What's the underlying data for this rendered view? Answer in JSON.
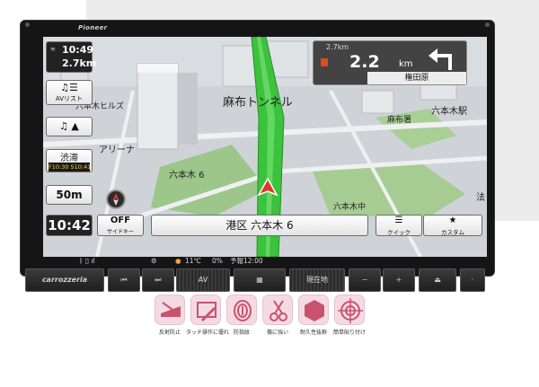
{
  "unit": {
    "brand": "Pioneer",
    "logo": "carrozzeria"
  },
  "top_left": {
    "signal": "≋",
    "time": "10:49",
    "distance": "2.7km"
  },
  "av_button": {
    "icon": "music-list-icon",
    "glyph": "♫☰",
    "label": "AVリスト"
  },
  "music_button": {
    "glyph": "♫ ▲"
  },
  "traffic": {
    "label": "渋滞",
    "times": "F10:30 S10:41"
  },
  "scale_label": "50m",
  "bottom_time": "10:42",
  "off_button": {
    "label": "OFF",
    "sub": "サイドキー"
  },
  "address": "港区 六本木 6",
  "quick_button": {
    "glyph": "☰",
    "label": "クイック"
  },
  "custom_button": {
    "glyph": "★",
    "label": "カスタム"
  },
  "guidance": {
    "small_distance": "2.7km",
    "distance": "2.2",
    "unit": "km",
    "place": "権田原",
    "direction": "left"
  },
  "map_labels": {
    "tunnel": "麻布トンネル",
    "roppongi_hills": "六本木ヒルズ",
    "arena": "アリーナ",
    "roppongi6": "六本木 6",
    "roppongi_naka": "六本木中",
    "azabu_police": "麻布署",
    "roppongi_station": "六本木駅",
    "ho": "法"
  },
  "status_bar": {
    "temp": "11℃",
    "precip": "0%",
    "forecast": "予報12:00"
  },
  "hardware_keys": {
    "prev": "⏮",
    "next": "⏭",
    "av": "AV",
    "menu": "▦",
    "current": "現在地",
    "vol_down": "−",
    "vol_up": "+",
    "eject": "⏏",
    "reset": "·"
  },
  "features": [
    {
      "label": "反射防止",
      "icon": "anti-glare-icon"
    },
    {
      "label": "タッチ操作に優れ",
      "icon": "touch-icon"
    },
    {
      "label": "防指紋",
      "icon": "fingerprint-icon"
    },
    {
      "label": "傷に強い",
      "icon": "scissors-icon"
    },
    {
      "label": "耐久性抜群",
      "icon": "durability-icon"
    },
    {
      "label": "簡単貼り付け",
      "icon": "easy-apply-icon"
    }
  ],
  "colors": {
    "route": "#3cc23c",
    "frame": "#151515",
    "feature_bg": "#f4dbe3",
    "feature_fg": "#c9536f"
  }
}
